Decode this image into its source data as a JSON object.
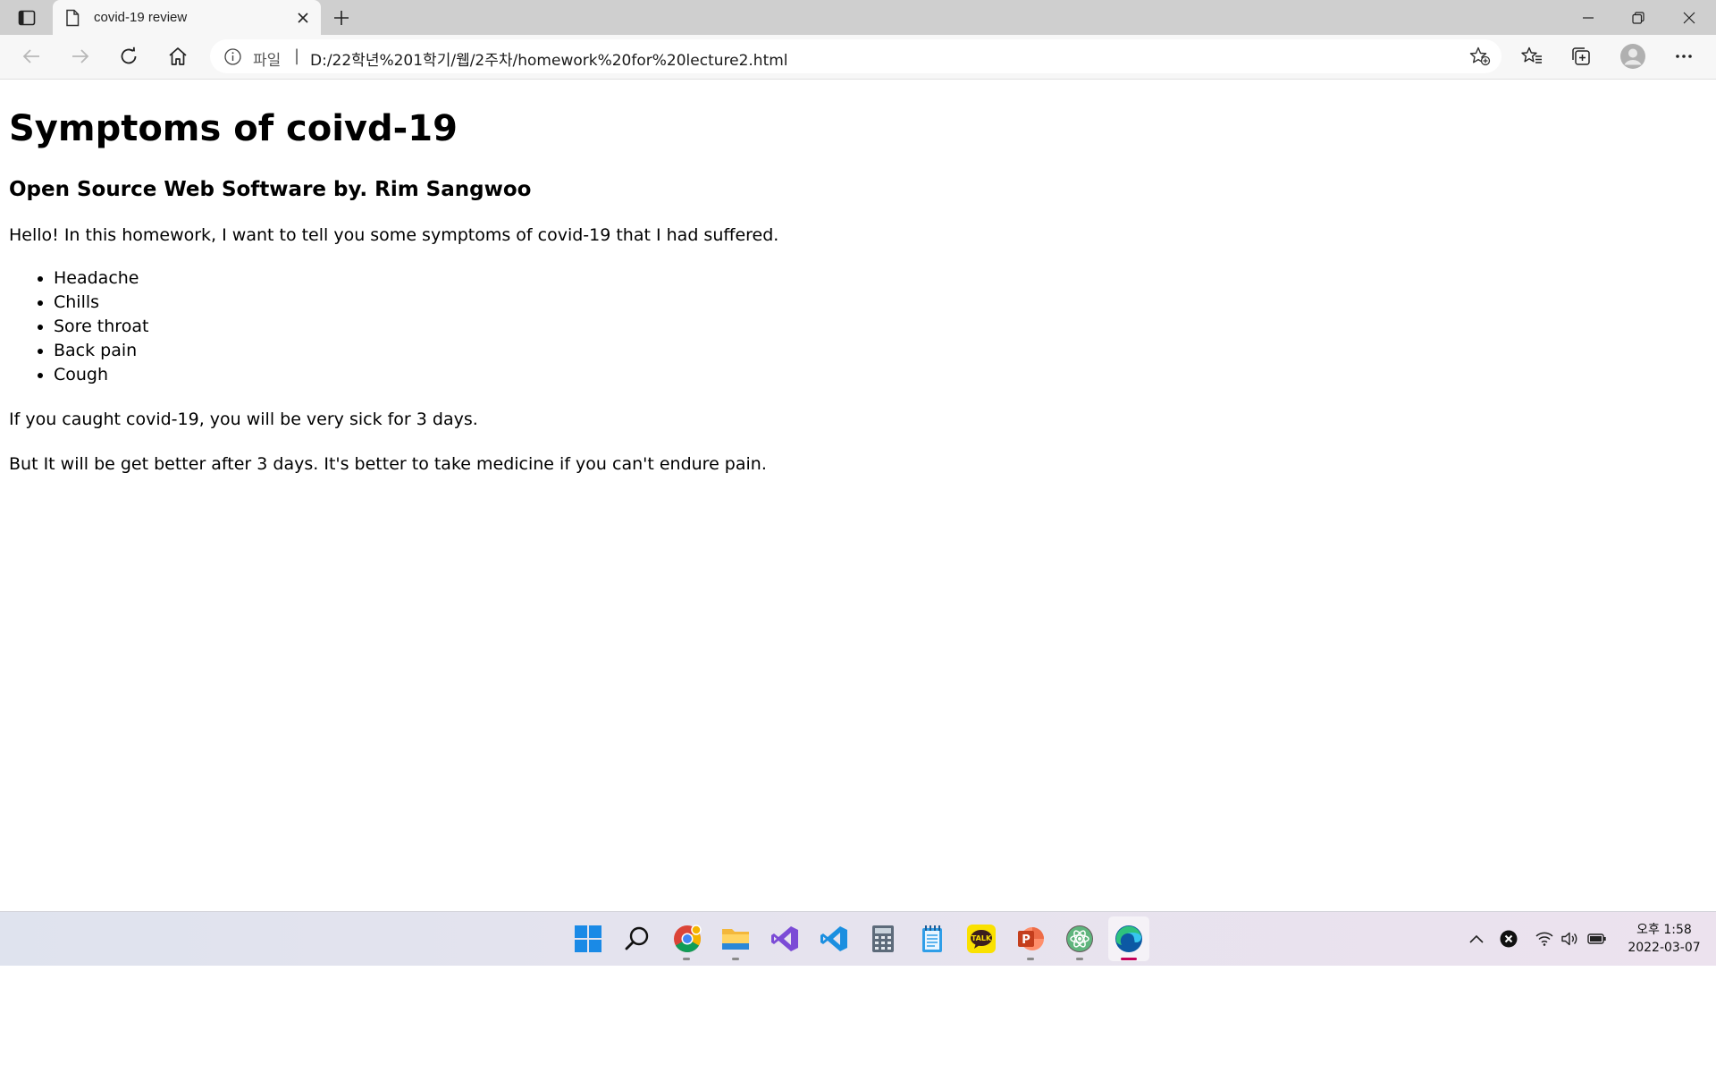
{
  "browser": {
    "tab": {
      "title": "covid-19 review"
    },
    "address": {
      "scheme": "파일",
      "separator": "|",
      "url": "D:/22학년%201학기/웹/2주차/homework%20for%20lecture2.html"
    }
  },
  "page": {
    "heading": "Symptoms of coivd-19",
    "subheading": "Open Source Web Software by. Rim Sangwoo",
    "intro": "Hello! In this homework, I want to tell you some symptoms of covid-19 that I had suffered.",
    "symptoms": [
      "Headache",
      "Chills",
      "Sore throat",
      "Back pain",
      "Cough"
    ],
    "paragraph_1": "If you caught covid-19, you will be very sick for 3 days.",
    "paragraph_2": "But It will be get better after 3 days. It's better to take medicine if you can't endure pain."
  },
  "taskbar": {
    "apps": [
      {
        "icon": "windows-start-icon"
      },
      {
        "icon": "search-icon"
      },
      {
        "icon": "chrome-icon",
        "running": true
      },
      {
        "icon": "file-explorer-icon",
        "running": true
      },
      {
        "icon": "visual-studio-icon"
      },
      {
        "icon": "vscode-icon"
      },
      {
        "icon": "calculator-icon"
      },
      {
        "icon": "notepad-icon"
      },
      {
        "icon": "kakaotalk-icon"
      },
      {
        "icon": "powerpoint-icon",
        "running": true
      },
      {
        "icon": "atom-icon",
        "running": true
      },
      {
        "icon": "edge-icon",
        "running": true,
        "active": true
      }
    ],
    "kakao_label": "TALK",
    "powerpoint_label": "P",
    "clock": {
      "time": "오후 1:58",
      "date": "2022-03-07"
    }
  },
  "colors": {
    "tabbar": "#cfcfcf",
    "toolbar": "#f7f7f7",
    "edge_active_indicator": "#c4005a",
    "windows_blue": "#1a8ae6"
  }
}
